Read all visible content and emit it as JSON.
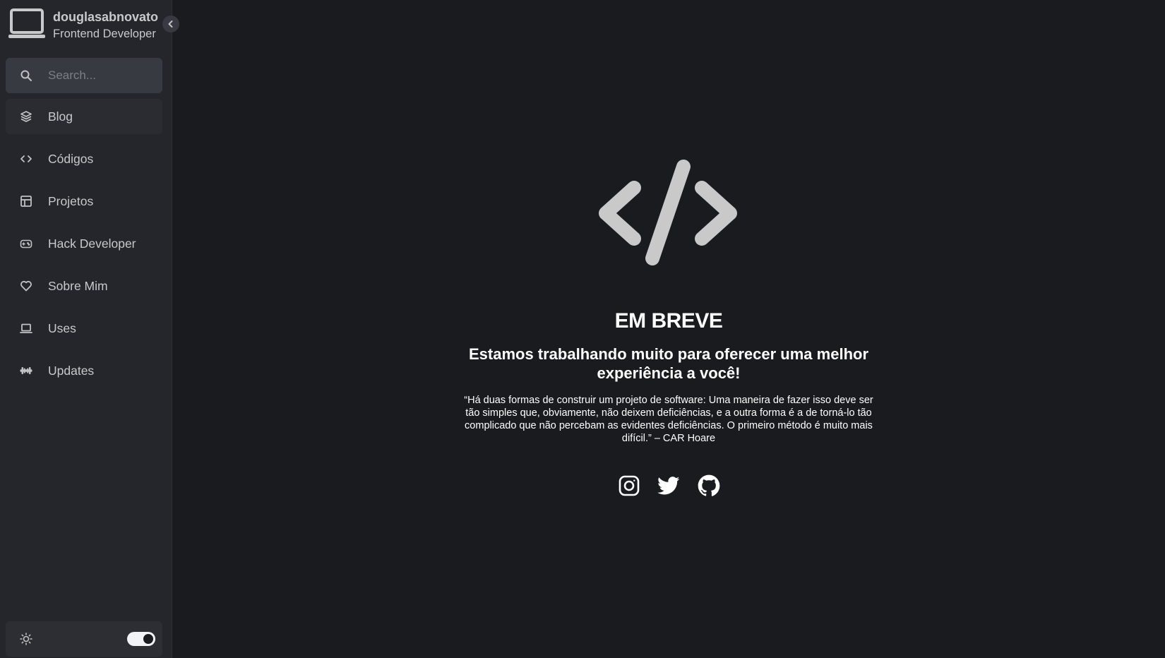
{
  "profile": {
    "name": "douglasabnovato",
    "role": "Frontend Developer",
    "avatar_icon": "laptop-icon"
  },
  "search": {
    "placeholder": "Search..."
  },
  "nav": {
    "items": [
      {
        "label": "Blog",
        "icon": "layers-icon",
        "active": true
      },
      {
        "label": "Códigos",
        "icon": "code-icon"
      },
      {
        "label": "Projetos",
        "icon": "layout-icon"
      },
      {
        "label": "Hack Developer",
        "icon": "gamepad-icon"
      },
      {
        "label": "Sobre Mim",
        "icon": "heart-icon"
      },
      {
        "label": "Uses",
        "icon": "laptop-icon"
      },
      {
        "label": "Updates",
        "icon": "barbell-icon"
      }
    ]
  },
  "theme": {
    "icon": "sun-icon",
    "dark_mode_on": true
  },
  "main": {
    "logo_icon": "code-slash-icon",
    "title": "EM BREVE",
    "subtitle": "Estamos trabalhando muito para oferecer uma melhor experiência a você!",
    "quote": "“Há duas formas de construir um projeto de software: Uma maneira de fazer isso deve ser tão simples que, obviamente, não deixem deficiências, e a outra forma é a de torná-lo tão complicado que não percebam as evidentes deficiências. O primeiro método é muito mais difícil.” – CAR Hoare",
    "social": [
      "instagram-icon",
      "twitter-icon",
      "github-icon"
    ]
  },
  "colors": {
    "background": "#1a1b1e",
    "sidebar": "#25262b",
    "search_bg": "#373a40",
    "text": "#c1c2c5",
    "logo": "#c9c9c9"
  }
}
